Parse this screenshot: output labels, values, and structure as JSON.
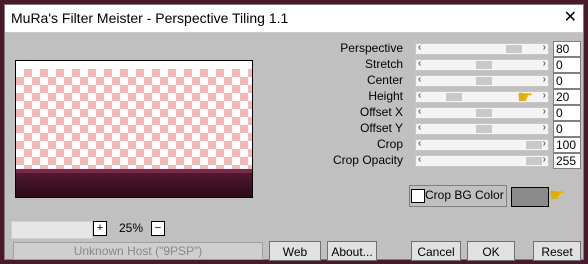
{
  "window": {
    "title": "MuRa's Filter Meister - Perspective Tiling 1.1",
    "close_label": "✕"
  },
  "preview": {
    "zoom": "25%",
    "plus_label": "+",
    "minus_label": "−",
    "status": "Unknown Host (\"9PSP\")"
  },
  "controls": [
    {
      "label": "Perspective",
      "value": "80",
      "slider_fraction": 0.8
    },
    {
      "label": "Stretch",
      "value": "0",
      "slider_fraction": 0.5
    },
    {
      "label": "Center",
      "value": "0",
      "slider_fraction": 0.5
    },
    {
      "label": "Height",
      "value": "20",
      "slider_fraction": 0.2
    },
    {
      "label": "Offset X",
      "value": "0",
      "slider_fraction": 0.5
    },
    {
      "label": "Offset Y",
      "value": "0",
      "slider_fraction": 0.5
    },
    {
      "label": "Crop",
      "value": "100",
      "slider_fraction": 1.0
    },
    {
      "label": "Crop Opacity",
      "value": "255",
      "slider_fraction": 1.0
    }
  ],
  "crop_bg": {
    "label": "Crop BG Color",
    "checked": false,
    "color": "#8a8a8a"
  },
  "buttons": {
    "web": "Web",
    "about": "About...",
    "cancel": "Cancel",
    "ok": "OK",
    "reset": "Reset"
  },
  "icons": {
    "hand_pointer": "pointing-hand-icon"
  }
}
